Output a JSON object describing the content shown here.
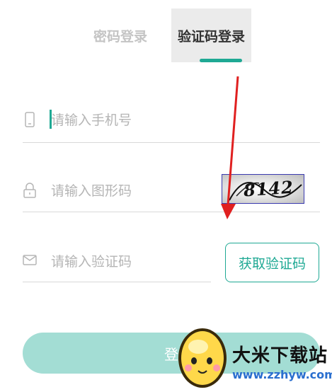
{
  "tabs": {
    "password_label": "密码登录",
    "sms_label": "验证码登录",
    "active": "sms"
  },
  "phone": {
    "placeholder": "请输入手机号",
    "icon": "phone-icon"
  },
  "captcha_input": {
    "placeholder": "请输入图形码",
    "icon": "lock-icon"
  },
  "captcha_image": {
    "code": "8142"
  },
  "sms_input": {
    "placeholder": "请输入验证码",
    "icon": "mail-icon"
  },
  "get_code_button": {
    "label": "获取验证码"
  },
  "login_button": {
    "label": "登"
  },
  "watermark": {
    "title": "大米下载站",
    "url": "www.zzhyw.com",
    "icon": "egg-mascot-icon"
  },
  "colors": {
    "accent": "#1fa994",
    "login_bg": "#a3ddd4",
    "annotation_arrow": "#e02020"
  }
}
